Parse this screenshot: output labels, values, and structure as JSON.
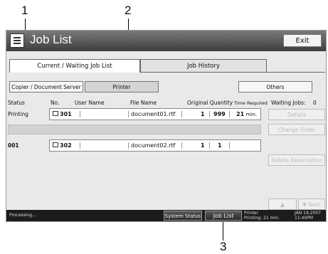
{
  "callouts": {
    "one": "1",
    "two": "2",
    "three": "3"
  },
  "window": {
    "title": "Job List",
    "exit_label": "Exit"
  },
  "tabs": [
    {
      "label": "Current / Waiting Job List"
    },
    {
      "label": "Job History"
    }
  ],
  "filters": {
    "copier_label": "Copier / Document Server",
    "printer_label": "Printer",
    "others_label": "Others"
  },
  "columns": {
    "status": "Status",
    "no": "No.",
    "user": "User Name",
    "file": "File Name",
    "orig_qty": "Original Quantity",
    "time_req": "Time Required",
    "waiting": "Waiting Jobs:",
    "waiting_count": "0"
  },
  "jobs": [
    {
      "status": "Printing",
      "no": "301",
      "user": "",
      "file": "document01.rtf",
      "original": "1",
      "quantity": "999",
      "time_num": "21",
      "time_unit": "min."
    },
    {
      "status": "001",
      "no": "302",
      "user": "",
      "file": "document02.rtf",
      "original": "1",
      "quantity": "1",
      "time_num": "",
      "time_unit": ""
    }
  ],
  "side_buttons": {
    "details": "Details",
    "change_order": "Change Order",
    "delete_reservation": "Delete Reservation",
    "previous": "▲ Previous",
    "next": "▼ Next"
  },
  "statusbar": {
    "left": "Processing...",
    "system_status": "System Status",
    "job_list": "Job List",
    "printer_line1": "Printer",
    "printer_line2": "Printing: 21 min.",
    "date": "JAN  19,2007",
    "time": "11:40PM"
  },
  "colors": {
    "titlebar": "#4a4a4a",
    "screen_bg": "#e9e9e9",
    "statusbar": "#1c1c1c"
  }
}
